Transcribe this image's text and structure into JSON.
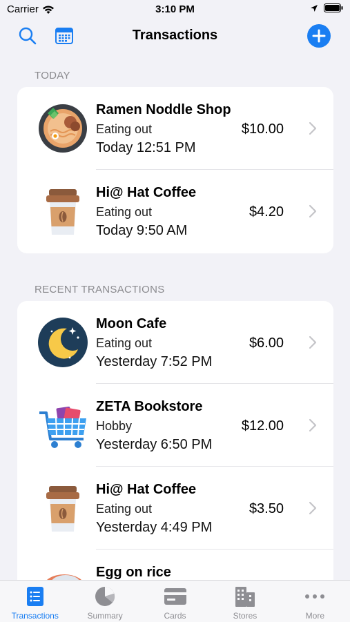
{
  "status": {
    "carrier": "Carrier",
    "time": "3:10 PM"
  },
  "nav": {
    "title": "Transactions",
    "left_icons": [
      "search-icon",
      "calendar-icon"
    ],
    "right_icon": "add-icon"
  },
  "sections": {
    "today": {
      "header": "TODAY",
      "rows": [
        {
          "name": "Ramen Noddle Shop",
          "category": "Eating out",
          "time": "Today 12:51 PM",
          "amount": "$10.00",
          "icon": "ramen-icon"
        },
        {
          "name": "Hi@ Hat Coffee",
          "category": "Eating out",
          "time": "Today 9:50 AM",
          "amount": "$4.20",
          "icon": "coffee-cup-icon"
        }
      ]
    },
    "recent": {
      "header": "RECENT TRANSACTIONS",
      "rows": [
        {
          "name": "Moon Cafe",
          "category": "Eating out",
          "time": "Yesterday 7:52 PM",
          "amount": "$6.00",
          "icon": "moon-icon"
        },
        {
          "name": "ZETA Bookstore",
          "category": "Hobby",
          "time": "Yesterday 6:50 PM",
          "amount": "$12.00",
          "icon": "shopping-cart-icon"
        },
        {
          "name": "Hi@ Hat Coffee",
          "category": "Eating out",
          "time": "Yesterday 4:49 PM",
          "amount": "$3.50",
          "icon": "coffee-cup-icon"
        },
        {
          "name": "Egg on rice",
          "category": "",
          "time": "",
          "amount": "",
          "icon": "egg-rice-icon"
        }
      ]
    }
  },
  "tabs": [
    {
      "label": "Transactions",
      "icon": "list-icon",
      "active": true
    },
    {
      "label": "Summary",
      "icon": "pie-chart-icon",
      "active": false
    },
    {
      "label": "Cards",
      "icon": "card-icon",
      "active": false
    },
    {
      "label": "Stores",
      "icon": "building-icon",
      "active": false
    },
    {
      "label": "More",
      "icon": "more-icon",
      "active": false
    }
  ],
  "colors": {
    "accent": "#1a7ef2",
    "background": "#f2f2f7",
    "inactive": "#8e8e93"
  }
}
